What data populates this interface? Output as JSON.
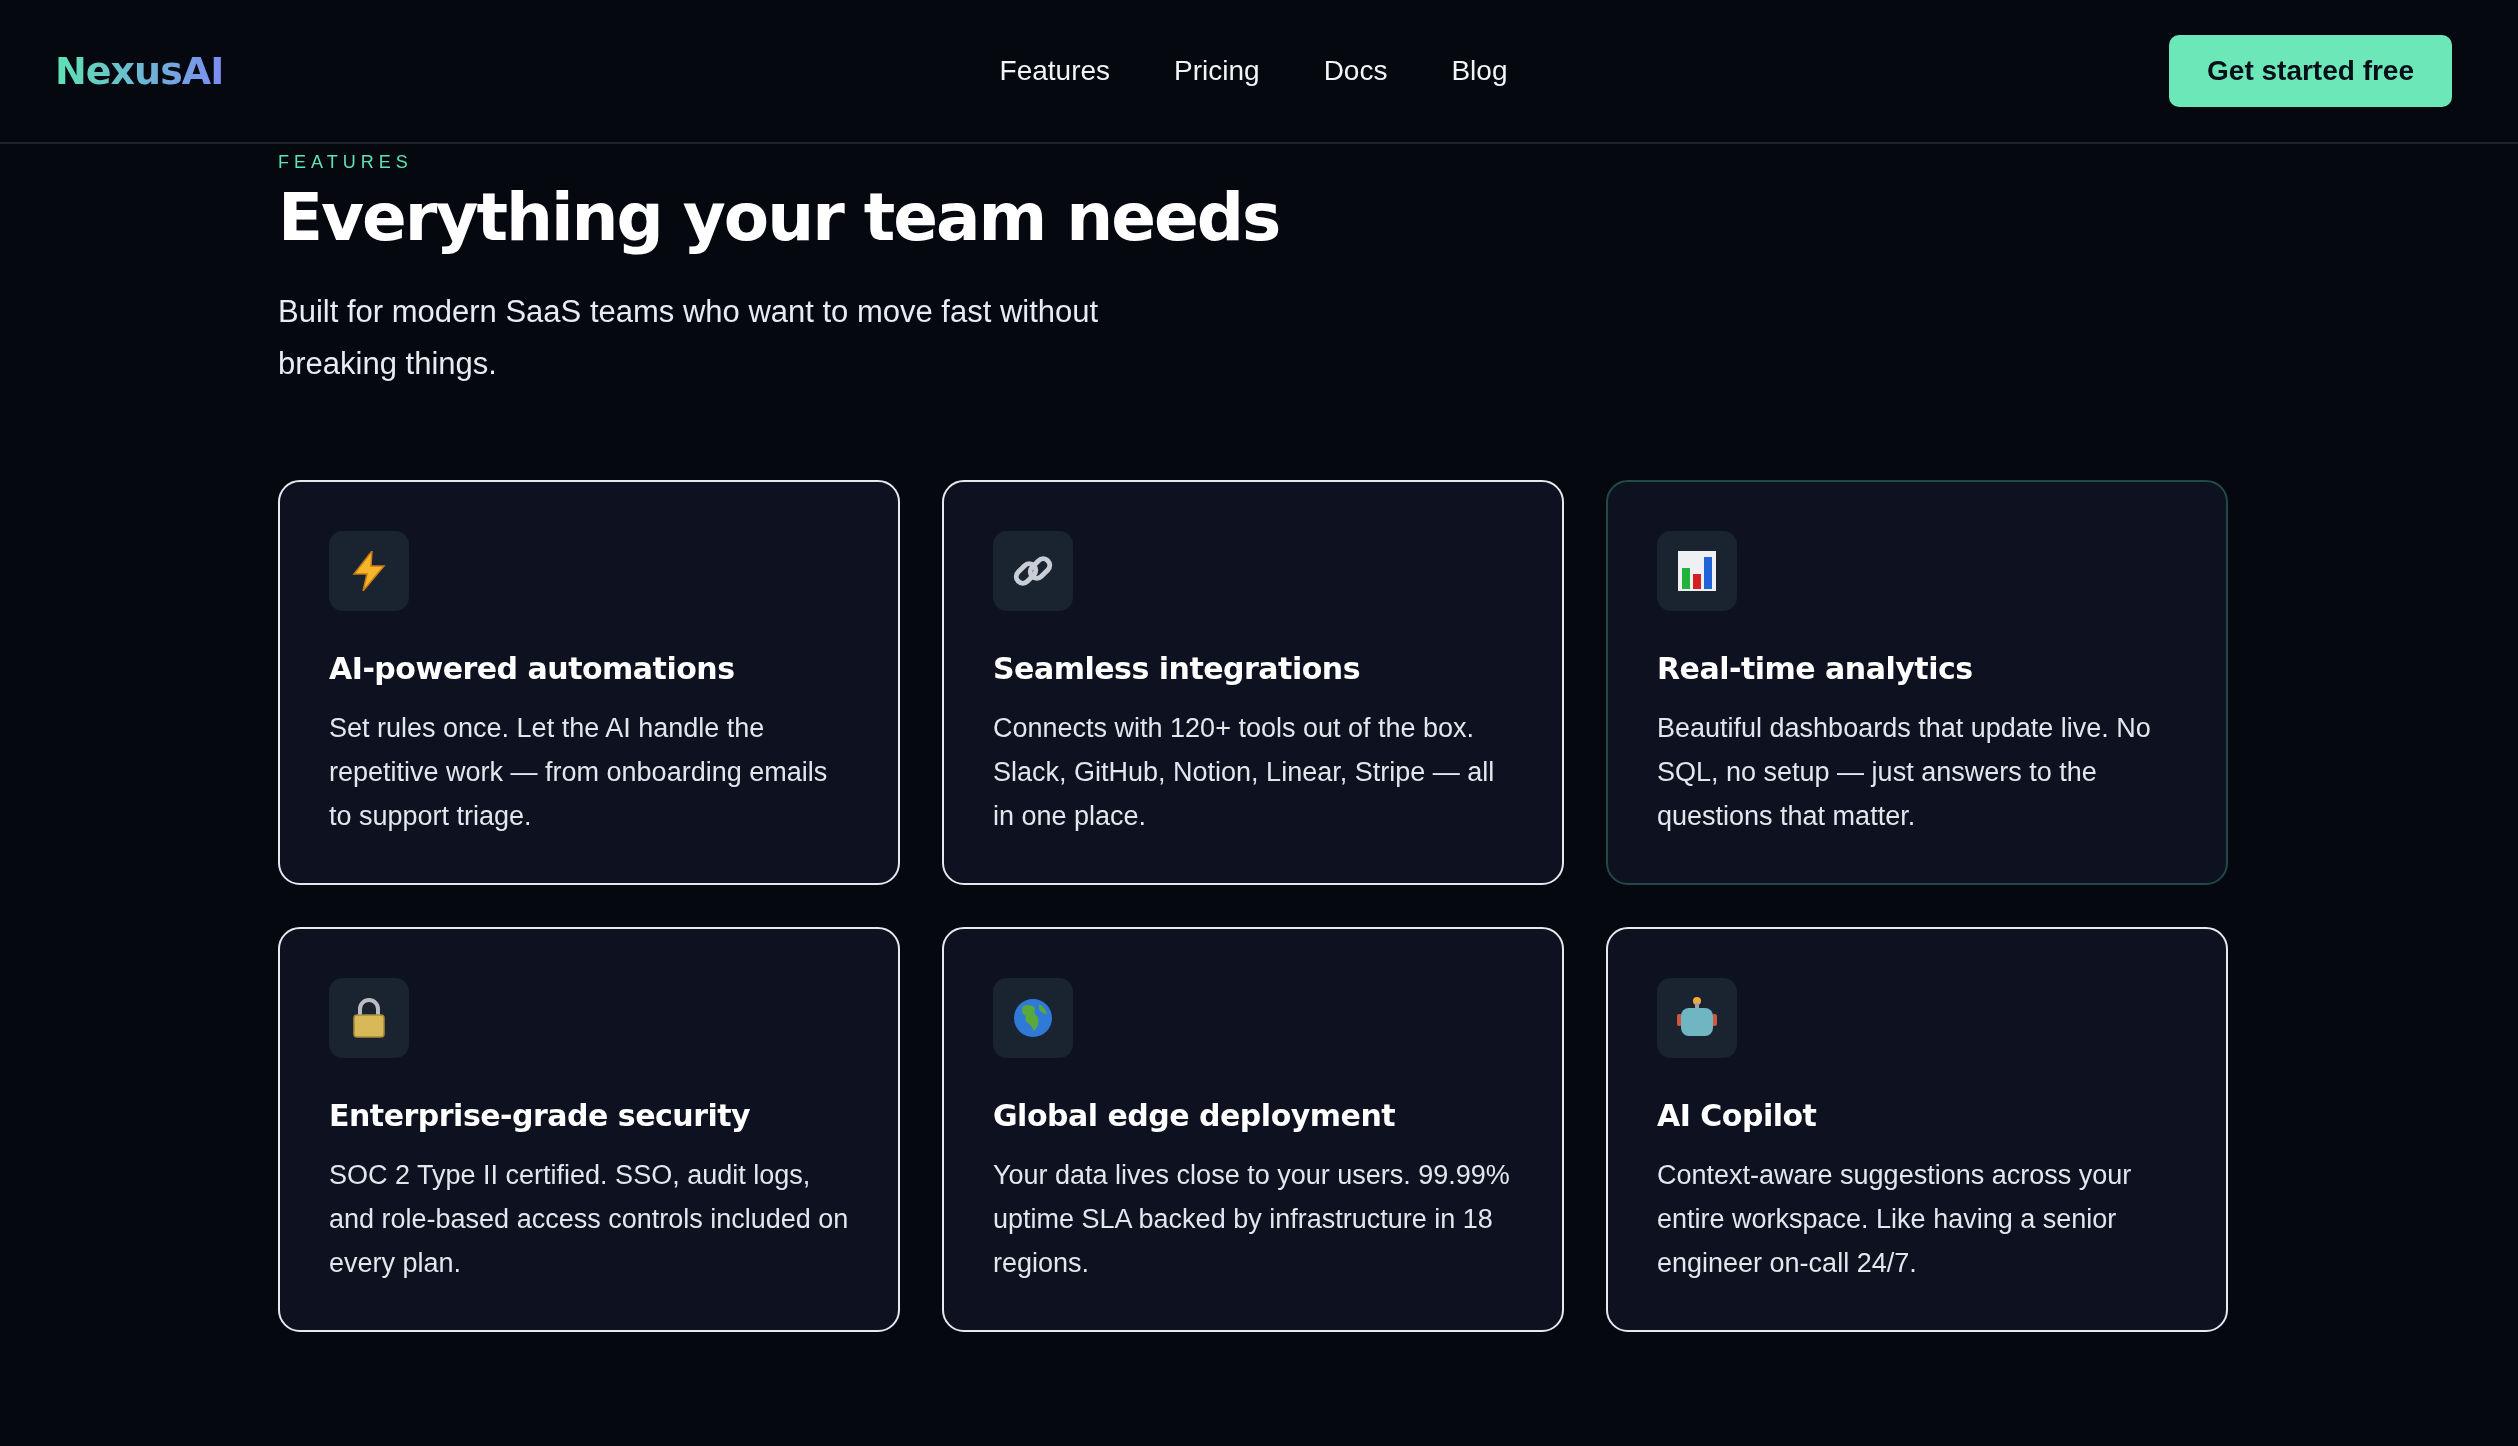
{
  "header": {
    "logo": "NexusAI",
    "nav": [
      {
        "label": "Features"
      },
      {
        "label": "Pricing"
      },
      {
        "label": "Docs"
      },
      {
        "label": "Blog"
      }
    ],
    "cta": "Get started free"
  },
  "section": {
    "eyebrow": "FEATURES",
    "title": "Everything your team needs",
    "subtitle": "Built for modern SaaS teams who want to move fast without breaking things."
  },
  "cards": [
    {
      "title": "AI-powered automations",
      "text": "Set rules once. Let the AI handle the repetitive work — from onboarding emails to support triage.",
      "highlighted": false
    },
    {
      "title": "Seamless integrations",
      "text": "Connects with 120+ tools out of the box. Slack, GitHub, Notion, Linear, Stripe — all in one place.",
      "highlighted": false
    },
    {
      "title": "Real-time analytics",
      "text": "Beautiful dashboards that update live. No SQL, no setup — just answers to the questions that matter.",
      "highlighted": true
    },
    {
      "title": "Enterprise-grade security",
      "text": "SOC 2 Type II certified. SSO, audit logs, and role-based access controls included on every plan.",
      "highlighted": false
    },
    {
      "title": "Global edge deployment",
      "text": "Your data lives close to your users. 99.99% uptime SLA backed by infrastructure in 18 regions.",
      "highlighted": false
    },
    {
      "title": "AI Copilot",
      "text": "Context-aware suggestions across your entire workspace. Like having a senior engineer on-call 24/7.",
      "highlighted": false
    }
  ]
}
